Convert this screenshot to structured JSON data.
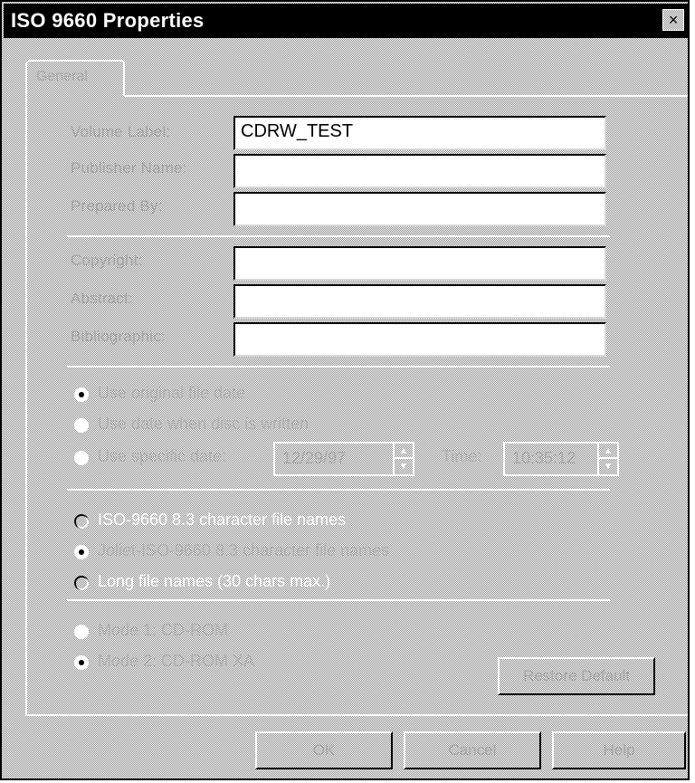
{
  "window": {
    "title": "ISO 9660 Properties",
    "close_icon": "close-icon"
  },
  "tabs": [
    {
      "label": "General"
    }
  ],
  "volume": {
    "volume_label_caption": "Volume Label:",
    "volume_label_value": "CDRW_TEST",
    "publisher_caption": "Publisher Name:",
    "publisher_value": "",
    "prepared_caption": "Prepared By:",
    "prepared_value": ""
  },
  "files": {
    "copyright_caption": "Copyright:",
    "copyright_value": "",
    "abstract_caption": "Abstract:",
    "abstract_value": "",
    "bibliographic_caption": "Bibliographic:",
    "bibliographic_value": ""
  },
  "date_options": [
    {
      "label": "Use original file date",
      "checked": true,
      "enabled": false
    },
    {
      "label": "Use date when disc is written",
      "checked": false,
      "enabled": false
    },
    {
      "label": "Use specific date:",
      "checked": false,
      "enabled": false
    }
  ],
  "specific_date": {
    "date_value": "12/29/97",
    "time_caption": "Time:",
    "time_value": "10:35:12"
  },
  "filename_options": [
    {
      "label": "ISO-9660 8.3 character file names",
      "checked": false,
      "enabled": true
    },
    {
      "label": "Joliet-ISO-9660 8.3 character file names",
      "checked": true,
      "enabled": false
    },
    {
      "label": "Long file names (30 chars max.)",
      "checked": false,
      "enabled": true
    }
  ],
  "mode_options": [
    {
      "label": "Mode 1: CD-ROM",
      "checked": false,
      "enabled": false
    },
    {
      "label": "Mode 2: CD-ROM XA",
      "checked": true,
      "enabled": false
    }
  ],
  "buttons": {
    "restore_default": "Restore Default",
    "ok": "OK",
    "cancel": "Cancel",
    "help": "Help"
  }
}
